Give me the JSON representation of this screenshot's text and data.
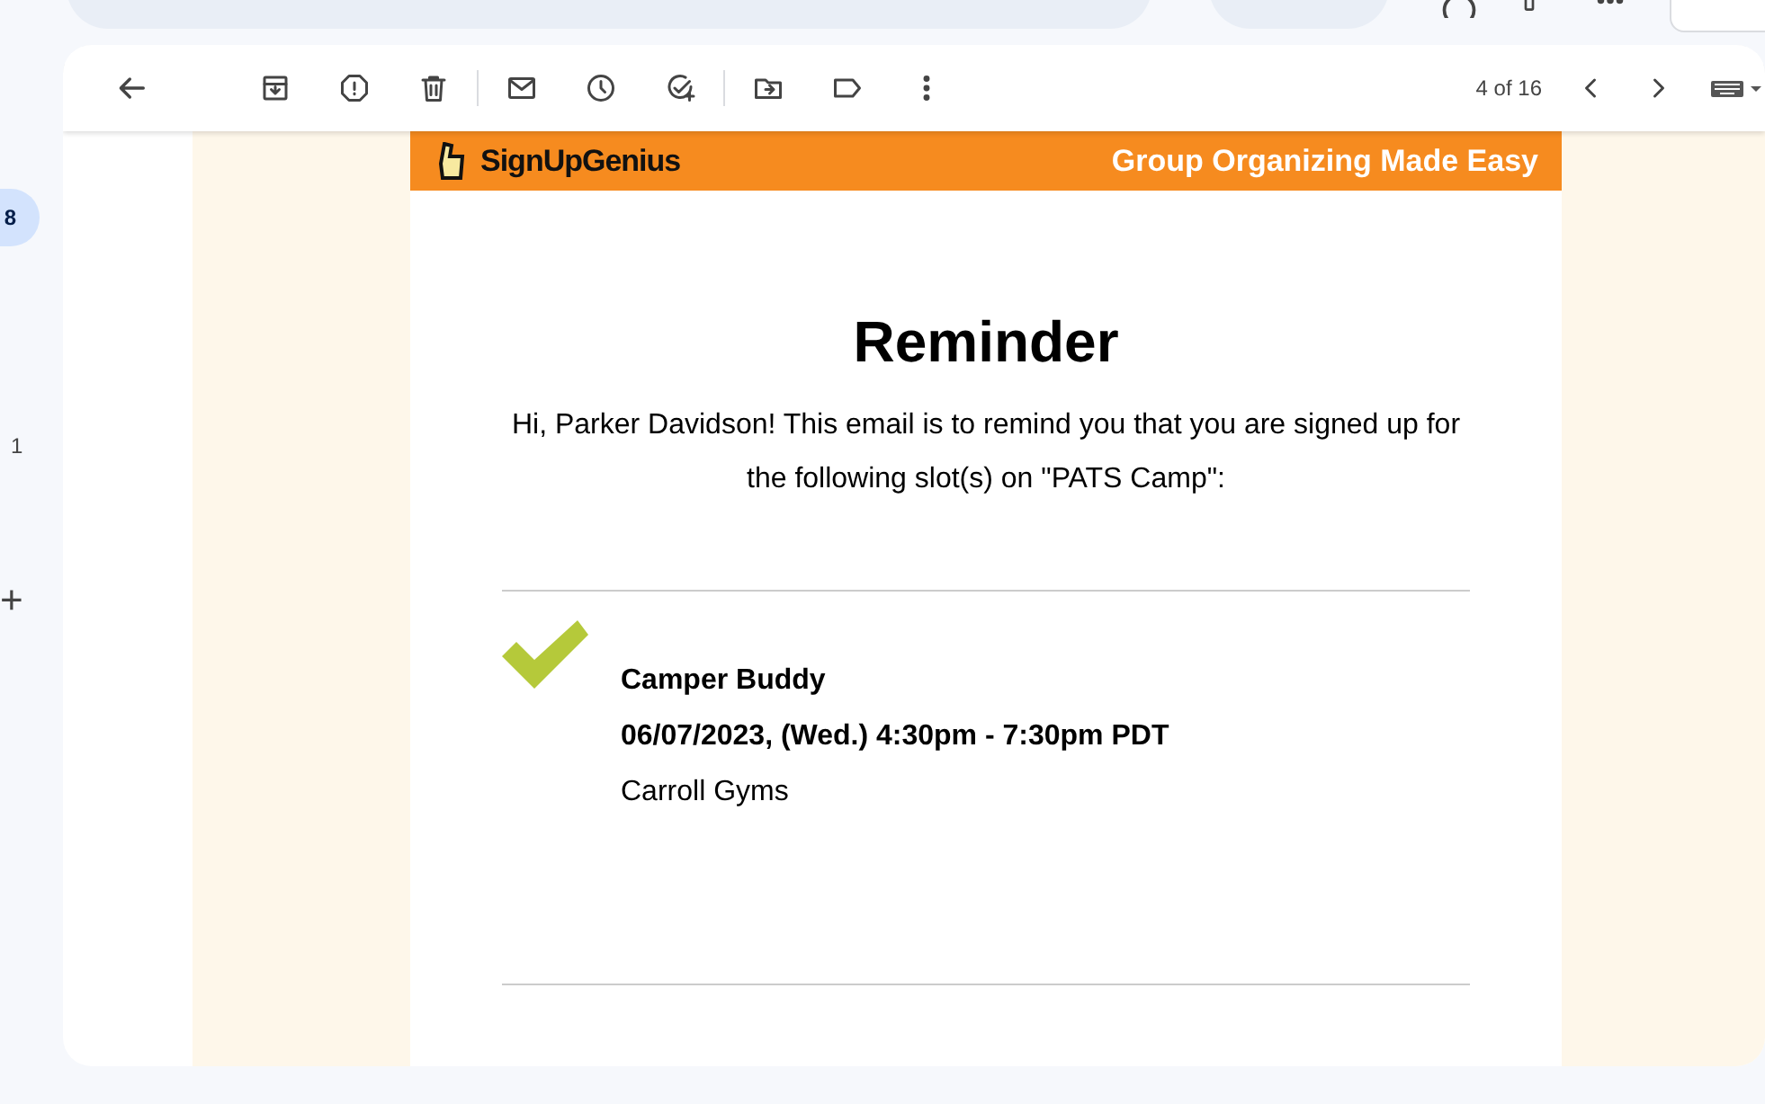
{
  "rail": {
    "badge": "8",
    "count": "1",
    "add": "+"
  },
  "toolbar": {
    "pagination": "4 of 16"
  },
  "email": {
    "brand": "SignUpGenius",
    "tagline": "Group Organizing Made Easy",
    "title": "Reminder",
    "message": "Hi, Parker Davidson! This email is to remind you that you are signed up for the following slot(s) on \"PATS Camp\":",
    "slots": [
      {
        "name": "Camper Buddy",
        "when": "06/07/2023, (Wed.) 4:30pm - 7:30pm PDT",
        "place": "Carroll Gyms"
      }
    ]
  }
}
